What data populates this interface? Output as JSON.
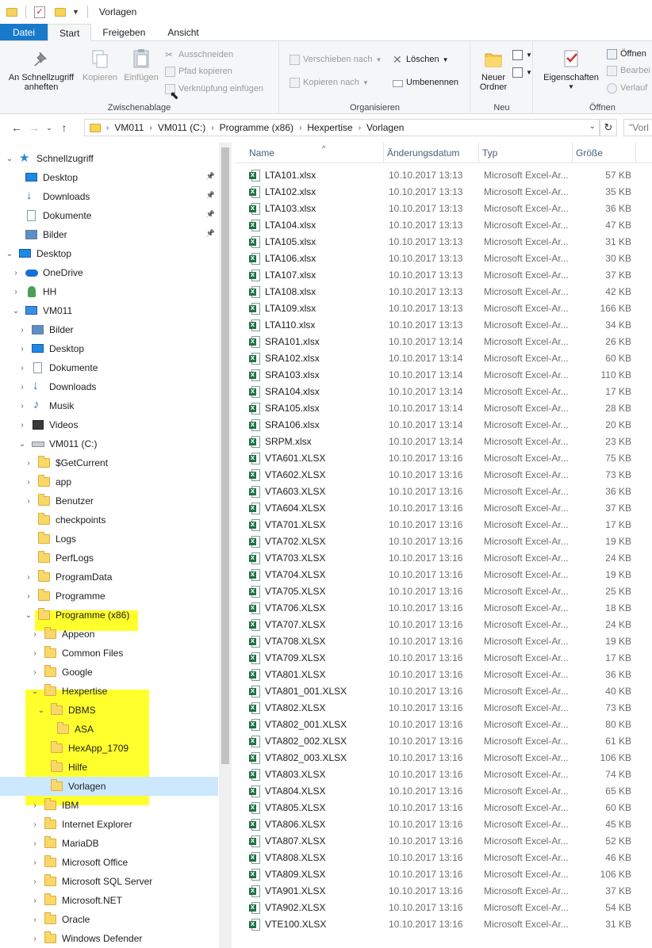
{
  "window": {
    "title": "Vorlagen"
  },
  "ribbon_tabs": [
    "Datei",
    "Start",
    "Freigeben",
    "Ansicht"
  ],
  "ribbon": {
    "pin_label_1": "An Schnellzugriff",
    "pin_label_2": "anheften",
    "copy": "Kopieren",
    "paste": "Einfügen",
    "cut": "Ausschneiden",
    "copy_path": "Pfad kopieren",
    "paste_shortcut": "Verknüpfung einfügen",
    "group_clipboard": "Zwischenablage",
    "move_to": "Verschieben nach",
    "copy_to": "Kopieren nach",
    "delete": "Löschen",
    "rename": "Umbenennen",
    "group_organize": "Organisieren",
    "new_folder_1": "Neuer",
    "new_folder_2": "Ordner",
    "group_new": "Neu",
    "properties": "Eigenschaften",
    "open": "Öffnen",
    "edit": "Bearbei",
    "history": "Verlauf",
    "group_open": "Öffnen"
  },
  "address": {
    "crumbs": [
      "VM011",
      "VM011 (C:)",
      "Programme (x86)",
      "Hexpertise",
      "Vorlagen"
    ],
    "search_placeholder": "\"Vorl"
  },
  "nav": [
    {
      "label": "Schnellzugriff",
      "level": 0,
      "icon": "star-icon",
      "chev": "down"
    },
    {
      "label": "Desktop",
      "level": 1,
      "icon": "desktop-icon",
      "pinned": true
    },
    {
      "label": "Downloads",
      "level": 1,
      "icon": "download-icon",
      "pinned": true
    },
    {
      "label": "Dokumente",
      "level": 1,
      "icon": "document-icon",
      "pinned": true
    },
    {
      "label": "Bilder",
      "level": 1,
      "icon": "pictures-icon",
      "pinned": true
    },
    {
      "label": "Desktop",
      "level": 0,
      "icon": "desktop-icon",
      "chev": "down"
    },
    {
      "label": "OneDrive",
      "level": 1,
      "icon": "cloud-icon",
      "chev": "right"
    },
    {
      "label": "HH",
      "level": 1,
      "icon": "user-icon",
      "chev": "right"
    },
    {
      "label": "VM011",
      "level": 1,
      "icon": "computer-icon",
      "chev": "down"
    },
    {
      "label": "Bilder",
      "level": 2,
      "icon": "pictures-icon",
      "chev": "right"
    },
    {
      "label": "Desktop",
      "level": 2,
      "icon": "desktop-icon",
      "chev": "right"
    },
    {
      "label": "Dokumente",
      "level": 2,
      "icon": "document-icon",
      "chev": "right"
    },
    {
      "label": "Downloads",
      "level": 2,
      "icon": "download-icon",
      "chev": "right"
    },
    {
      "label": "Musik",
      "level": 2,
      "icon": "music-icon",
      "chev": "right"
    },
    {
      "label": "Videos",
      "level": 2,
      "icon": "video-icon",
      "chev": "right"
    },
    {
      "label": "VM011 (C:)",
      "level": 2,
      "icon": "drive-icon",
      "chev": "down"
    },
    {
      "label": "$GetCurrent",
      "level": 3,
      "icon": "folder-icon",
      "chev": "right"
    },
    {
      "label": "app",
      "level": 3,
      "icon": "folder-icon",
      "chev": "right"
    },
    {
      "label": "Benutzer",
      "level": 3,
      "icon": "folder-icon",
      "chev": "right"
    },
    {
      "label": "checkpoints",
      "level": 3,
      "icon": "folder-icon"
    },
    {
      "label": "Logs",
      "level": 3,
      "icon": "folder-icon"
    },
    {
      "label": "PerfLogs",
      "level": 3,
      "icon": "folder-icon"
    },
    {
      "label": "ProgramData",
      "level": 3,
      "icon": "folder-icon",
      "chev": "right"
    },
    {
      "label": "Programme",
      "level": 3,
      "icon": "folder-icon",
      "chev": "right"
    },
    {
      "label": "Programme (x86)",
      "level": 3,
      "icon": "folder-icon",
      "chev": "down"
    },
    {
      "label": "Appeon",
      "level": 4,
      "icon": "folder-icon",
      "chev": "right"
    },
    {
      "label": "Common Files",
      "level": 4,
      "icon": "folder-icon",
      "chev": "right"
    },
    {
      "label": "Google",
      "level": 4,
      "icon": "folder-icon",
      "chev": "right"
    },
    {
      "label": "Hexpertise",
      "level": 4,
      "icon": "folder-icon",
      "chev": "down"
    },
    {
      "label": "DBMS",
      "level": 5,
      "icon": "folder-icon",
      "chev": "down"
    },
    {
      "label": "ASA",
      "level": 6,
      "icon": "folder-icon"
    },
    {
      "label": "HexApp_1709",
      "level": 5,
      "icon": "folder-icon"
    },
    {
      "label": "Hilfe",
      "level": 5,
      "icon": "folder-icon"
    },
    {
      "label": "Vorlagen",
      "level": 5,
      "icon": "folder-icon",
      "selected": true
    },
    {
      "label": "IBM",
      "level": 4,
      "icon": "folder-icon",
      "chev": "right"
    },
    {
      "label": "Internet Explorer",
      "level": 4,
      "icon": "folder-icon",
      "chev": "right"
    },
    {
      "label": "MariaDB",
      "level": 4,
      "icon": "folder-icon",
      "chev": "right"
    },
    {
      "label": "Microsoft Office",
      "level": 4,
      "icon": "folder-icon",
      "chev": "right"
    },
    {
      "label": "Microsoft SQL Server",
      "level": 4,
      "icon": "folder-icon",
      "chev": "right"
    },
    {
      "label": "Microsoft.NET",
      "level": 4,
      "icon": "folder-icon",
      "chev": "right"
    },
    {
      "label": "Oracle",
      "level": 4,
      "icon": "folder-icon",
      "chev": "right"
    },
    {
      "label": "Windows Defender",
      "level": 4,
      "icon": "folder-icon",
      "chev": "right"
    }
  ],
  "columns": {
    "name": "Name",
    "date": "Änderungsdatum",
    "type": "Typ",
    "size": "Größe"
  },
  "files": [
    {
      "name": "LTA101.xlsx",
      "date": "10.10.2017 13:13",
      "type": "Microsoft Excel-Ar...",
      "size": "57 KB"
    },
    {
      "name": "LTA102.xlsx",
      "date": "10.10.2017 13:13",
      "type": "Microsoft Excel-Ar...",
      "size": "35 KB"
    },
    {
      "name": "LTA103.xlsx",
      "date": "10.10.2017 13:13",
      "type": "Microsoft Excel-Ar...",
      "size": "36 KB"
    },
    {
      "name": "LTA104.xlsx",
      "date": "10.10.2017 13:13",
      "type": "Microsoft Excel-Ar...",
      "size": "47 KB"
    },
    {
      "name": "LTA105.xlsx",
      "date": "10.10.2017 13:13",
      "type": "Microsoft Excel-Ar...",
      "size": "31 KB"
    },
    {
      "name": "LTA106.xlsx",
      "date": "10.10.2017 13:13",
      "type": "Microsoft Excel-Ar...",
      "size": "30 KB"
    },
    {
      "name": "LTA107.xlsx",
      "date": "10.10.2017 13:13",
      "type": "Microsoft Excel-Ar...",
      "size": "37 KB"
    },
    {
      "name": "LTA108.xlsx",
      "date": "10.10.2017 13:13",
      "type": "Microsoft Excel-Ar...",
      "size": "42 KB"
    },
    {
      "name": "LTA109.xlsx",
      "date": "10.10.2017 13:13",
      "type": "Microsoft Excel-Ar...",
      "size": "166 KB"
    },
    {
      "name": "LTA110.xlsx",
      "date": "10.10.2017 13:13",
      "type": "Microsoft Excel-Ar...",
      "size": "34 KB"
    },
    {
      "name": "SRA101.xlsx",
      "date": "10.10.2017 13:14",
      "type": "Microsoft Excel-Ar...",
      "size": "26 KB"
    },
    {
      "name": "SRA102.xlsx",
      "date": "10.10.2017 13:14",
      "type": "Microsoft Excel-Ar...",
      "size": "60 KB"
    },
    {
      "name": "SRA103.xlsx",
      "date": "10.10.2017 13:14",
      "type": "Microsoft Excel-Ar...",
      "size": "110 KB"
    },
    {
      "name": "SRA104.xlsx",
      "date": "10.10.2017 13:14",
      "type": "Microsoft Excel-Ar...",
      "size": "17 KB"
    },
    {
      "name": "SRA105.xlsx",
      "date": "10.10.2017 13:14",
      "type": "Microsoft Excel-Ar...",
      "size": "28 KB"
    },
    {
      "name": "SRA106.xlsx",
      "date": "10.10.2017 13:14",
      "type": "Microsoft Excel-Ar...",
      "size": "20 KB"
    },
    {
      "name": "SRPM.xlsx",
      "date": "10.10.2017 13:14",
      "type": "Microsoft Excel-Ar...",
      "size": "23 KB"
    },
    {
      "name": "VTA601.XLSX",
      "date": "10.10.2017 13:16",
      "type": "Microsoft Excel-Ar...",
      "size": "75 KB"
    },
    {
      "name": "VTA602.XLSX",
      "date": "10.10.2017 13:16",
      "type": "Microsoft Excel-Ar...",
      "size": "73 KB"
    },
    {
      "name": "VTA603.XLSX",
      "date": "10.10.2017 13:16",
      "type": "Microsoft Excel-Ar...",
      "size": "36 KB"
    },
    {
      "name": "VTA604.XLSX",
      "date": "10.10.2017 13:16",
      "type": "Microsoft Excel-Ar...",
      "size": "37 KB"
    },
    {
      "name": "VTA701.XLSX",
      "date": "10.10.2017 13:16",
      "type": "Microsoft Excel-Ar...",
      "size": "17 KB"
    },
    {
      "name": "VTA702.XLSX",
      "date": "10.10.2017 13:16",
      "type": "Microsoft Excel-Ar...",
      "size": "19 KB"
    },
    {
      "name": "VTA703.XLSX",
      "date": "10.10.2017 13:16",
      "type": "Microsoft Excel-Ar...",
      "size": "24 KB"
    },
    {
      "name": "VTA704.XLSX",
      "date": "10.10.2017 13:16",
      "type": "Microsoft Excel-Ar...",
      "size": "19 KB"
    },
    {
      "name": "VTA705.XLSX",
      "date": "10.10.2017 13:16",
      "type": "Microsoft Excel-Ar...",
      "size": "25 KB"
    },
    {
      "name": "VTA706.XLSX",
      "date": "10.10.2017 13:16",
      "type": "Microsoft Excel-Ar...",
      "size": "18 KB"
    },
    {
      "name": "VTA707.XLSX",
      "date": "10.10.2017 13:16",
      "type": "Microsoft Excel-Ar...",
      "size": "24 KB"
    },
    {
      "name": "VTA708.XLSX",
      "date": "10.10.2017 13:16",
      "type": "Microsoft Excel-Ar...",
      "size": "19 KB"
    },
    {
      "name": "VTA709.XLSX",
      "date": "10.10.2017 13:16",
      "type": "Microsoft Excel-Ar...",
      "size": "17 KB"
    },
    {
      "name": "VTA801.XLSX",
      "date": "10.10.2017 13:16",
      "type": "Microsoft Excel-Ar...",
      "size": "36 KB"
    },
    {
      "name": "VTA801_001.XLSX",
      "date": "10.10.2017 13:16",
      "type": "Microsoft Excel-Ar...",
      "size": "40 KB"
    },
    {
      "name": "VTA802.XLSX",
      "date": "10.10.2017 13:16",
      "type": "Microsoft Excel-Ar...",
      "size": "73 KB"
    },
    {
      "name": "VTA802_001.XLSX",
      "date": "10.10.2017 13:16",
      "type": "Microsoft Excel-Ar...",
      "size": "80 KB"
    },
    {
      "name": "VTA802_002.XLSX",
      "date": "10.10.2017 13:16",
      "type": "Microsoft Excel-Ar...",
      "size": "61 KB"
    },
    {
      "name": "VTA802_003.XLSX",
      "date": "10.10.2017 13:16",
      "type": "Microsoft Excel-Ar...",
      "size": "106 KB"
    },
    {
      "name": "VTA803.XLSX",
      "date": "10.10.2017 13:16",
      "type": "Microsoft Excel-Ar...",
      "size": "74 KB"
    },
    {
      "name": "VTA804.XLSX",
      "date": "10.10.2017 13:16",
      "type": "Microsoft Excel-Ar...",
      "size": "65 KB"
    },
    {
      "name": "VTA805.XLSX",
      "date": "10.10.2017 13:16",
      "type": "Microsoft Excel-Ar...",
      "size": "60 KB"
    },
    {
      "name": "VTA806.XLSX",
      "date": "10.10.2017 13:16",
      "type": "Microsoft Excel-Ar...",
      "size": "45 KB"
    },
    {
      "name": "VTA807.XLSX",
      "date": "10.10.2017 13:16",
      "type": "Microsoft Excel-Ar...",
      "size": "52 KB"
    },
    {
      "name": "VTA808.XLSX",
      "date": "10.10.2017 13:16",
      "type": "Microsoft Excel-Ar...",
      "size": "46 KB"
    },
    {
      "name": "VTA809.XLSX",
      "date": "10.10.2017 13:16",
      "type": "Microsoft Excel-Ar...",
      "size": "106 KB"
    },
    {
      "name": "VTA901.XLSX",
      "date": "10.10.2017 13:16",
      "type": "Microsoft Excel-Ar...",
      "size": "37 KB"
    },
    {
      "name": "VTA902.XLSX",
      "date": "10.10.2017 13:16",
      "type": "Microsoft Excel-Ar...",
      "size": "54 KB"
    },
    {
      "name": "VTE100.XLSX",
      "date": "10.10.2017 13:16",
      "type": "Microsoft Excel-Ar...",
      "size": "31 KB"
    }
  ],
  "colors": {
    "accent": "#1979ca",
    "highlight": "#ffff2e",
    "selection": "#cce8ff",
    "excel": "#1e7145"
  }
}
